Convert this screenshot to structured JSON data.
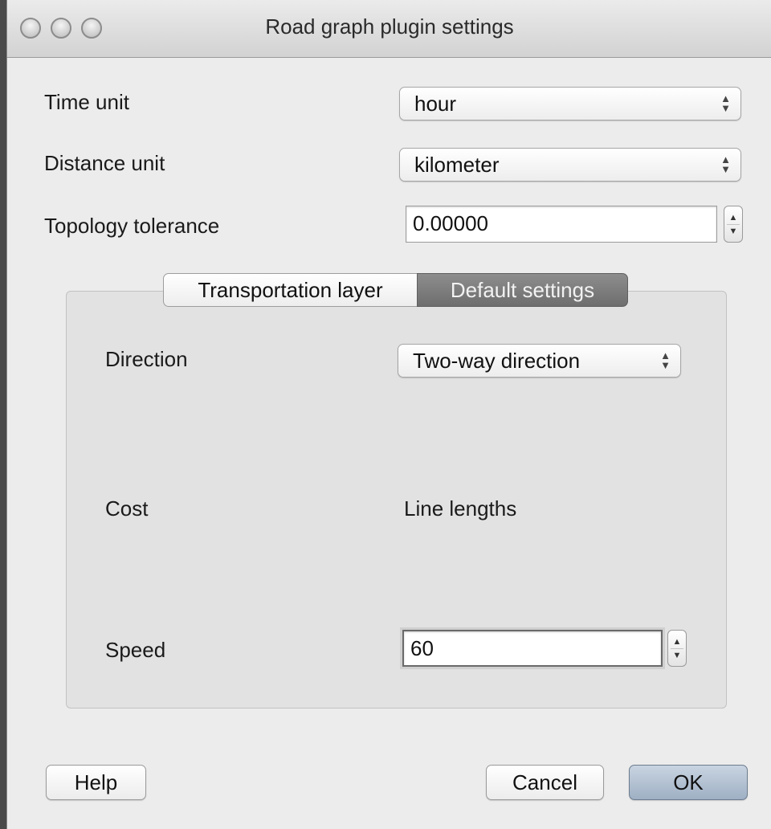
{
  "window": {
    "title": "Road graph plugin settings"
  },
  "general": {
    "time_unit_label": "Time unit",
    "time_unit_value": "hour",
    "distance_unit_label": "Distance unit",
    "distance_unit_value": "kilometer",
    "topology_tolerance_label": "Topology tolerance",
    "topology_tolerance_value": "0.00000"
  },
  "tabs": [
    {
      "label": "Transportation layer",
      "selected": false
    },
    {
      "label": "Default settings",
      "selected": true
    }
  ],
  "default_settings": {
    "direction_label": "Direction",
    "direction_value": "Two-way direction",
    "cost_label": "Cost",
    "cost_value": "Line lengths",
    "speed_label": "Speed",
    "speed_value": "60"
  },
  "buttons": {
    "help": "Help",
    "cancel": "Cancel",
    "ok": "OK"
  },
  "icons": {
    "popup_arrows": "up-down-chevron-icon",
    "stepper_arrows": "stepper-icon"
  },
  "colors": {
    "window_bg": "#ececec",
    "tab_active_bg": "#7d7d7d",
    "default_button": "#b4c2d3"
  }
}
